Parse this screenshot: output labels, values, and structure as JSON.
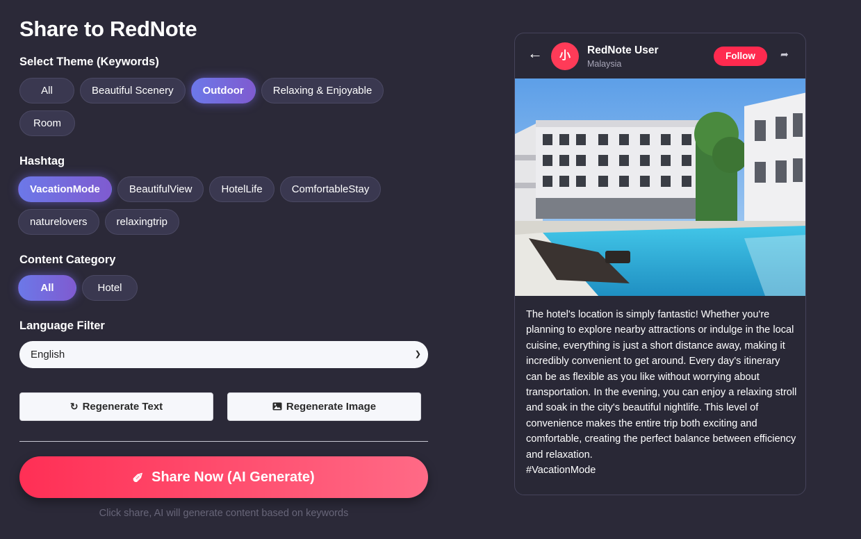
{
  "page_title": "Share to RedNote",
  "theme": {
    "label": "Select Theme (Keywords)",
    "options": [
      "All",
      "Beautiful Scenery",
      "Outdoor",
      "Relaxing & Enjoyable",
      "Room"
    ],
    "selected": "Outdoor"
  },
  "hashtag": {
    "label": "Hashtag",
    "options": [
      "VacationMode",
      "BeautifulView",
      "HotelLife",
      "ComfortableStay",
      "naturelovers",
      "relaxingtrip"
    ],
    "selected": "VacationMode"
  },
  "category": {
    "label": "Content Category",
    "options": [
      "All",
      "Hotel"
    ],
    "selected": "All"
  },
  "language": {
    "label": "Language Filter",
    "value": "English"
  },
  "buttons": {
    "regen_text": "Regenerate Text",
    "regen_image": "Regenerate Image",
    "share": "Share Now (AI Generate)"
  },
  "hint": "Click share, AI will generate content based on keywords",
  "preview": {
    "back_icon": "arrow-left-icon",
    "avatar_text": "小",
    "user_name": "RedNote User",
    "location": "Malaysia",
    "follow_label": "Follow",
    "share_icon": "share-icon",
    "post_text": "The hotel's location is simply fantastic! Whether you're planning to explore nearby attractions or indulge in the local cuisine, everything is just a short distance away, making it incredibly convenient to get around. Every day's itinerary can be as flexible as you like without worrying about transportation. In the evening, you can enjoy a relaxing stroll and soak in the city's beautiful nightlife. This level of convenience makes the entire trip both exciting and comfortable, creating the perfect balance between efficiency and relaxation.",
    "post_hashtag": "#VacationMode"
  },
  "colors": {
    "background": "#2b2938",
    "accent_red": "#ff2a4f",
    "chip_active": "#6c78e8"
  }
}
